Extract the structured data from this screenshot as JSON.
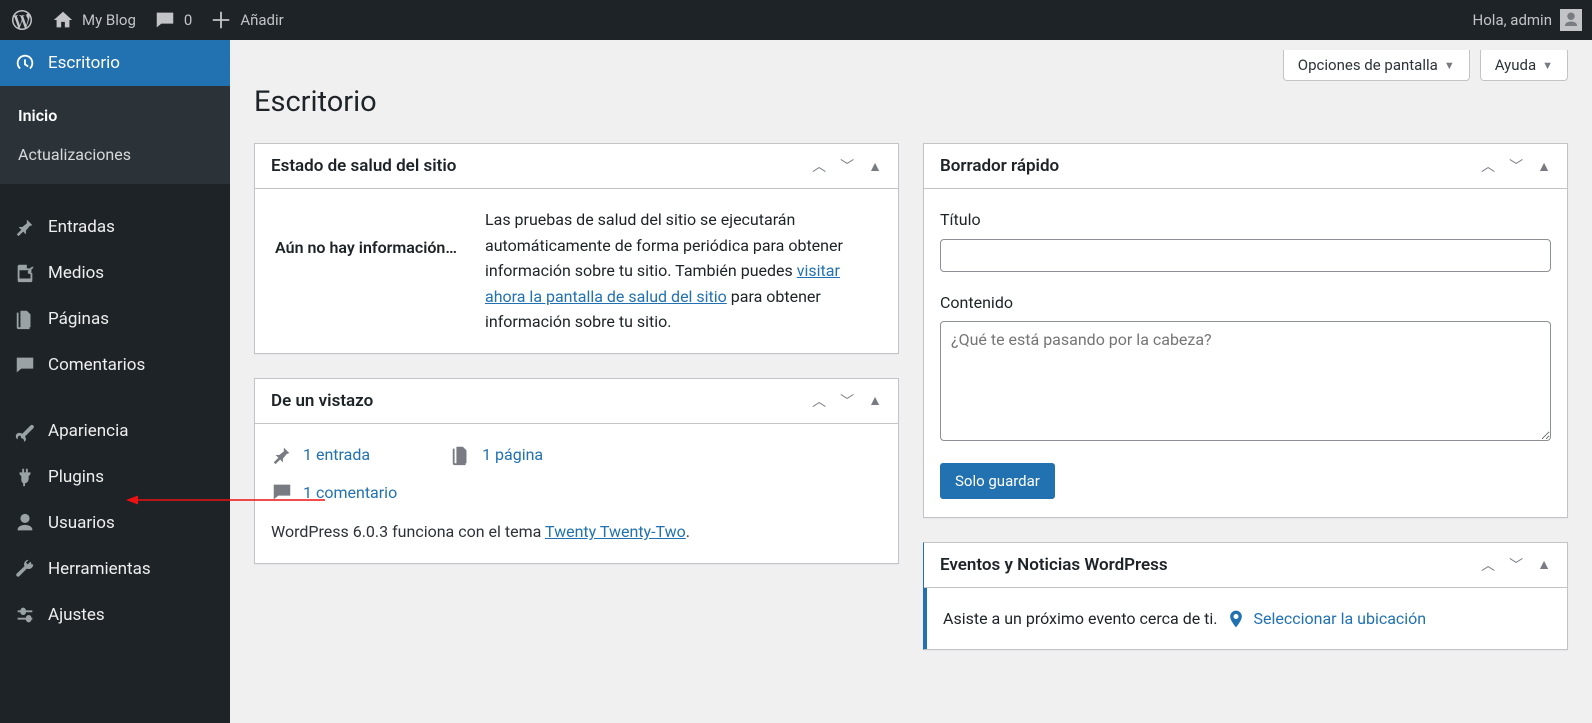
{
  "admin_bar": {
    "site_name": "My Blog",
    "comments_count": "0",
    "add_new": "Añadir",
    "greeting": "Hola, admin"
  },
  "sidebar": {
    "dashboard": "Escritorio",
    "submenu": {
      "home": "Inicio",
      "updates": "Actualizaciones"
    },
    "posts": "Entradas",
    "media": "Medios",
    "pages": "Páginas",
    "comments": "Comentarios",
    "appearance": "Apariencia",
    "plugins": "Plugins",
    "users": "Usuarios",
    "tools": "Herramientas",
    "settings": "Ajustes"
  },
  "top_tabs": {
    "screen_options": "Opciones de pantalla",
    "help": "Ayuda"
  },
  "page_title": "Escritorio",
  "health_box": {
    "title": "Estado de salud del sitio",
    "no_info": "Aún no hay información…",
    "text_a": "Las pruebas de salud del sitio se ejecutarán automáticamente de forma periódica para obtener información sobre tu sitio. También puedes ",
    "link": "visitar ahora la pantalla de salud del sitio",
    "text_b": " para obtener información sobre tu sitio."
  },
  "glance_box": {
    "title": "De un vistazo",
    "posts": "1 entrada",
    "pages": "1 página",
    "comments": "1 comentario",
    "footer_a": "WordPress 6.0.3 funciona con el tema ",
    "theme": "Twenty Twenty-Two",
    "footer_b": "."
  },
  "quick_draft": {
    "title": "Borrador rápido",
    "title_label": "Título",
    "content_label": "Contenido",
    "content_placeholder": "¿Qué te está pasando por la cabeza?",
    "save": "Solo guardar"
  },
  "events_box": {
    "title": "Eventos y Noticias WordPress",
    "text": "Asiste a un próximo evento cerca de ti.",
    "link": "Seleccionar la ubicación"
  }
}
